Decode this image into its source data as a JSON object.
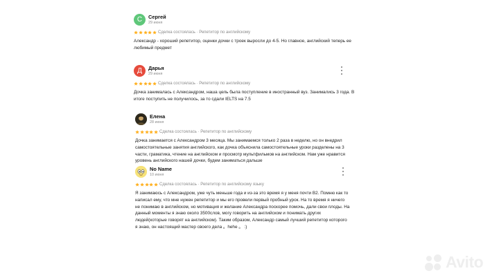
{
  "reviews": [
    {
      "name": "Сергей",
      "date": "29 июня",
      "avatar_letter": "С",
      "avatar_color": "#5fc77a",
      "meta": "Сделка состоялась · Репетитор по английскому",
      "text": "Александр - хороший репетитор, оценки дочки с троек выросли до 4-5. Но главное, английский теперь ее любимый предмет"
    },
    {
      "name": "Дарья",
      "date": "29 июня",
      "avatar_letter": "Д",
      "avatar_color": "#e64b3c",
      "meta": "Сделка состоялась · Репетитор по английскому",
      "text": "Дочка занималась с Александром, наша цель была поступление в иностранный вуз. Занимались 3 года. В итоге поступить не получилось, за то сдали IELTS на 7.5"
    },
    {
      "name": "Елена",
      "date": "28 июня",
      "avatar_letter": "",
      "avatar_color": "#3b3b2a",
      "meta": "Сделка состоялась · Репетитор по английскому",
      "text": "Дочка занимается с Александром 3 месяца. Мы занимаемся только 2 раза в неделю, но он внедрил самостоятельные занятия английского, как дочка объяснила самостоятельные уроки разделены на 3 части, граматика, чтение на английском и просмотр мультфильмов на английском. Нам уже нравится уровень английского нашей дочки, будем заниматься дальше"
    },
    {
      "name": "No Name",
      "date": "10 июня",
      "avatar_letter": "",
      "avatar_color": "#f6e27a",
      "meta": "Сделка состоялась · Репетитор по английскому языку",
      "text": "Я занимаюсь с Александром, уже чуть меньше года и из-за это время я у меня почти B2. Помню как то написал ему, что мне нужен репетитор и мы его провели первый пробный урок. На то время я ничего не понимаю в английском, но мотивация и желание Александра поскорее помочь, дали свои плоды. На данный моменты я знаю около 3500слов, могу говорить на английском и понимать других людей(которые говорят на английском). Таким образом, Александр самый лучший репетитор которого я знаю, он настоящий мастер своего дела 。hehe 。 :)"
    }
  ],
  "rating_stars": 5,
  "star_color": "#ffb020",
  "watermark": "Avito"
}
